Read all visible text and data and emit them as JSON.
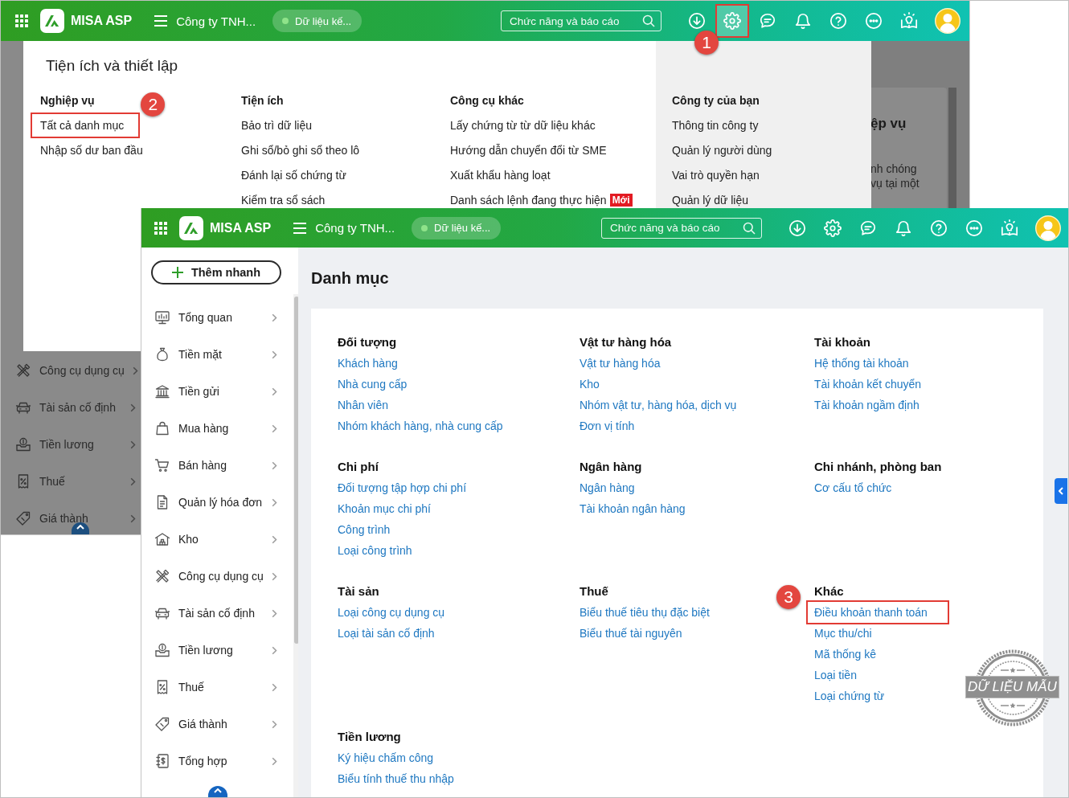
{
  "back_window": {
    "topbar": {
      "app_name": "MISA ASP",
      "company": "Công ty TNH...",
      "data_status": "Dữ liệu kế...",
      "search": {
        "placeholder": "Chức năng và báo cáo"
      },
      "icons": [
        {
          "kind": "download",
          "selected": false,
          "highlighted": false
        },
        {
          "kind": "settings",
          "selected": true,
          "highlighted": true,
          "callout": "1"
        },
        {
          "kind": "chat",
          "selected": false,
          "highlighted": false
        },
        {
          "kind": "bell",
          "selected": false,
          "highlighted": false
        },
        {
          "kind": "help",
          "selected": false,
          "highlighted": false
        },
        {
          "kind": "more",
          "selected": false,
          "highlighted": false
        },
        {
          "kind": "guide",
          "selected": false,
          "highlighted": false
        }
      ]
    },
    "sidebar": {
      "items": [
        {
          "label": "Công cụ dụng cụ",
          "kind": "tools"
        },
        {
          "label": "Tài sản cố định",
          "kind": "assets"
        },
        {
          "label": "Tiền lương",
          "kind": "payroll"
        },
        {
          "label": "Thuế",
          "kind": "tax"
        },
        {
          "label": "Giá thành",
          "kind": "cost"
        }
      ]
    },
    "settings_panel": {
      "title": "Tiện ích và thiết lập",
      "columns": [
        {
          "heading": "Nghiệp vụ",
          "items": [
            {
              "label": "Tất cả danh mục",
              "highlighted": true,
              "callout": "2"
            },
            {
              "label": "Nhập số dư ban đầu",
              "highlighted": false
            }
          ]
        },
        {
          "heading": "Tiện ích",
          "items": [
            {
              "label": "Bảo trì dữ liệu",
              "highlighted": false
            },
            {
              "label": "Ghi sổ/bỏ ghi sổ theo lô",
              "highlighted": false
            },
            {
              "label": "Đánh lại số chứng từ",
              "highlighted": false
            },
            {
              "label": "Kiểm tra sổ sách",
              "highlighted": false
            }
          ]
        },
        {
          "heading": "Công cụ khác",
          "items": [
            {
              "label": "Lấy chứng từ từ dữ liệu khác",
              "highlighted": false
            },
            {
              "label": "Hướng dẫn chuyển đổi từ SME",
              "highlighted": false
            },
            {
              "label": "Xuất khẩu hàng loạt",
              "highlighted": false
            },
            {
              "label": "Danh sách lệnh đang thực hiện",
              "highlighted": false,
              "badge": "Mới"
            }
          ]
        }
      ],
      "company_column": {
        "heading": "Công ty của bạn",
        "items": [
          {
            "label": "Thông tin công ty",
            "highlighted": false
          },
          {
            "label": "Quản lý người dùng",
            "highlighted": false
          },
          {
            "label": "Vai trò quyền hạn",
            "highlighted": false
          },
          {
            "label": "Quản lý dữ liệu",
            "highlighted": false
          }
        ]
      }
    },
    "background_card": {
      "heading": "ệp vụ",
      "lines": [
        "nh chóng",
        "vụ tại một"
      ]
    }
  },
  "front_window": {
    "topbar": {
      "app_name": "MISA ASP",
      "company": "Công ty TNH...",
      "data_status": "Dữ liệu kế...",
      "search": {
        "placeholder": "Chức năng và báo cáo"
      },
      "icons": [
        {
          "kind": "download",
          "selected": false,
          "highlighted": false
        },
        {
          "kind": "settings",
          "selected": false,
          "highlighted": false
        },
        {
          "kind": "chat",
          "selected": false,
          "highlighted": false
        },
        {
          "kind": "bell",
          "selected": false,
          "highlighted": false
        },
        {
          "kind": "help",
          "selected": false,
          "highlighted": false
        },
        {
          "kind": "more",
          "selected": false,
          "highlighted": false
        },
        {
          "kind": "guide",
          "selected": false,
          "highlighted": false
        }
      ]
    },
    "sidebar": {
      "quick_add": "Thêm nhanh",
      "items": [
        {
          "label": "Tổng quan",
          "kind": "overview"
        },
        {
          "label": "Tiền mặt",
          "kind": "cash"
        },
        {
          "label": "Tiền gửi",
          "kind": "deposit"
        },
        {
          "label": "Mua hàng",
          "kind": "purchase"
        },
        {
          "label": "Bán hàng",
          "kind": "sales"
        },
        {
          "label": "Quản lý hóa đơn",
          "kind": "invoice"
        },
        {
          "label": "Kho",
          "kind": "warehouse"
        },
        {
          "label": "Công cụ dụng cụ",
          "kind": "tools"
        },
        {
          "label": "Tài sản cố định",
          "kind": "assets"
        },
        {
          "label": "Tiền lương",
          "kind": "payroll"
        },
        {
          "label": "Thuế",
          "kind": "tax"
        },
        {
          "label": "Giá thành",
          "kind": "cost"
        },
        {
          "label": "Tổng hợp",
          "kind": "ledger"
        }
      ]
    },
    "page_title": "Danh mục",
    "groups": [
      {
        "heading": "Đối tượng",
        "links": [
          {
            "label": "Khách hàng",
            "highlighted": false
          },
          {
            "label": "Nhà cung cấp",
            "highlighted": false
          },
          {
            "label": "Nhân viên",
            "highlighted": false
          },
          {
            "label": "Nhóm khách hàng, nhà cung cấp",
            "highlighted": false
          }
        ]
      },
      {
        "heading": "Vật tư hàng hóa",
        "links": [
          {
            "label": "Vật tư hàng hóa",
            "highlighted": false
          },
          {
            "label": "Kho",
            "highlighted": false
          },
          {
            "label": "Nhóm vật tư, hàng hóa, dịch vụ",
            "highlighted": false
          },
          {
            "label": "Đơn vị tính",
            "highlighted": false
          }
        ]
      },
      {
        "heading": "Tài khoản",
        "links": [
          {
            "label": "Hệ thống tài khoản",
            "highlighted": false
          },
          {
            "label": "Tài khoản kết chuyển",
            "highlighted": false
          },
          {
            "label": "Tài khoản ngầm định",
            "highlighted": false
          }
        ]
      },
      {
        "heading": "Chi phí",
        "links": [
          {
            "label": "Đối tượng tập hợp chi phí",
            "highlighted": false
          },
          {
            "label": "Khoản mục chi phí",
            "highlighted": false
          },
          {
            "label": "Công trình",
            "highlighted": false
          },
          {
            "label": "Loại công trình",
            "highlighted": false
          }
        ]
      },
      {
        "heading": "Ngân hàng",
        "links": [
          {
            "label": "Ngân hàng",
            "highlighted": false
          },
          {
            "label": "Tài khoản ngân hàng",
            "highlighted": false
          }
        ]
      },
      {
        "heading": "Chi nhánh, phòng ban",
        "links": [
          {
            "label": "Cơ cấu tổ chức",
            "highlighted": false
          }
        ]
      },
      {
        "heading": "Tài sản",
        "links": [
          {
            "label": "Loại công cụ dụng cụ",
            "highlighted": false
          },
          {
            "label": "Loại tài sản cố định",
            "highlighted": false
          }
        ]
      },
      {
        "heading": "Thuế",
        "links": [
          {
            "label": "Biểu thuế tiêu thụ đặc biệt",
            "highlighted": false
          },
          {
            "label": "Biểu thuế tài nguyên",
            "highlighted": false
          }
        ]
      },
      {
        "heading": "Khác",
        "links": [
          {
            "label": "Điều khoản thanh toán",
            "highlighted": true,
            "callout": "3"
          },
          {
            "label": "Mục thu/chi",
            "highlighted": false
          },
          {
            "label": "Mã thống kê",
            "highlighted": false
          },
          {
            "label": "Loại tiền",
            "highlighted": false
          },
          {
            "label": "Loại chứng từ",
            "highlighted": false
          }
        ]
      },
      {
        "heading": "Tiền lương",
        "links": [
          {
            "label": "Ký hiệu chấm công",
            "highlighted": false
          },
          {
            "label": "Biểu tính thuế thu nhập",
            "highlighted": false
          }
        ]
      }
    ],
    "sample_stamp": "DỮ LIỆU MẪU"
  }
}
